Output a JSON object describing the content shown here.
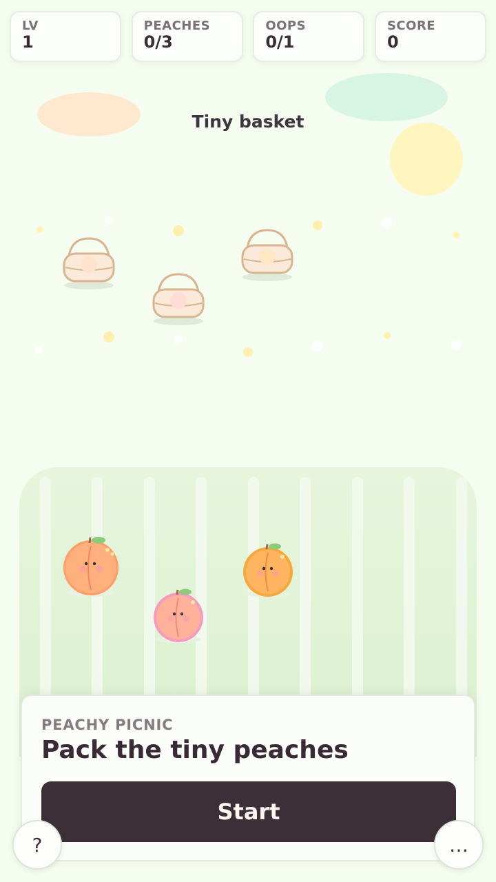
{
  "hud": {
    "stats": [
      {
        "label": "LV",
        "value": "1"
      },
      {
        "label": "PEACHES",
        "value": "0/3"
      },
      {
        "label": "OOPS",
        "value": "0/1"
      },
      {
        "label": "SCORE",
        "value": "0"
      }
    ]
  },
  "level": {
    "title": "Tiny basket"
  },
  "baskets": [
    {
      "name": "basket-1",
      "inner_color": "#ffe3cc"
    },
    {
      "name": "basket-2",
      "inner_color": "#ffdcd6"
    },
    {
      "name": "basket-3",
      "inner_color": "#ffe6c4"
    }
  ],
  "peaches": [
    {
      "name": "peach-orange",
      "body_color": "#ffb07d",
      "rim_color": "#ff9d6a"
    },
    {
      "name": "peach-pink",
      "body_color": "#ffb19a",
      "rim_color": "#f79ac0"
    },
    {
      "name": "peach-golden",
      "body_color": "#ffb45f",
      "rim_color": "#f5a93c"
    }
  ],
  "panel": {
    "kicker": "PEACHY PICNIC",
    "title": "Pack the tiny peaches",
    "start_label": "Start"
  },
  "buttons": {
    "help_label": "?",
    "more_label": "…"
  },
  "colors": {
    "background": "#f4fdef",
    "accent_dark": "#3c2f37",
    "field": "#e2f3d6"
  }
}
